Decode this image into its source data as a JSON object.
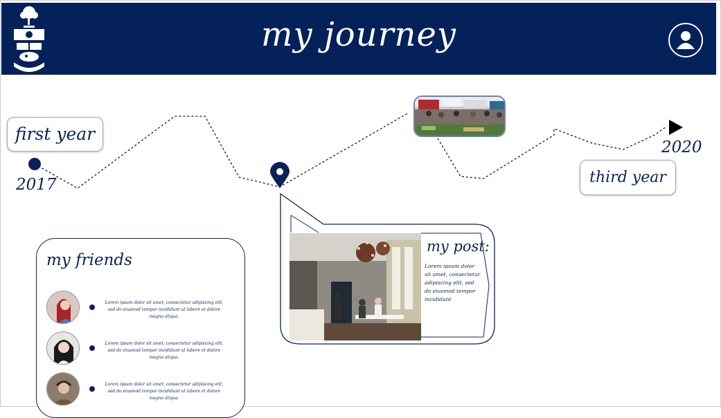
{
  "header": {
    "title": "my journey",
    "background_color": "#04215a",
    "profile_icon": "user-icon",
    "logo_icon": "university-crest-icon"
  },
  "timeline": {
    "start_label": "first year",
    "start_year": "2017",
    "end_label": "third year",
    "end_year": "2020",
    "milestone_icon": "map-pin-icon",
    "end_icon": "play-arrow-icon",
    "market_photo": "market-photo"
  },
  "friends": {
    "title": "my friends",
    "items": [
      {
        "text": "Lorem ipsum dolor sit amet, consectetur adipiscing elit, sed do eiusmod tempor incididunt ut labore et dolore magna aliqua."
      },
      {
        "text": "Lorem ipsum dolor sit amet, consectetur adipiscing elit, sed do eiusmod tempor incididunt ut labore et dolore magna aliqua."
      },
      {
        "text": "Lorem ipsum dolor sit amet, consectetur adipiscing elit, sed do eiusmod tempor incididunt ut labore et dolore magna aliqua."
      }
    ]
  },
  "post": {
    "title": "my post:",
    "text": "Lorem ipsum dolor sit amet, consectetur adipiscing elit, sed do eiusmod tempor incididunt",
    "photo": "restaurant-photo"
  },
  "colors": {
    "navy": "#0b2157",
    "white": "#ffffff"
  }
}
